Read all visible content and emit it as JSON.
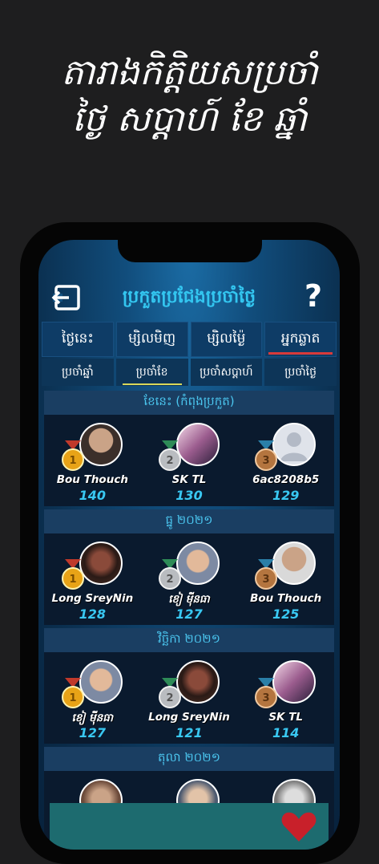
{
  "promo": {
    "line1": "តារាងកិត្តិយសប្រចាំ",
    "line2": "ថ្ងៃ សប្ដាហ៍ ខែ ឆ្នាំ"
  },
  "header": {
    "title": "ប្រកួតប្រជែងប្រចាំថ្ងៃ",
    "help_label": "?"
  },
  "tabs": [
    {
      "label": "ថ្ងៃនេះ",
      "active": false
    },
    {
      "label": "ម្សិលមិញ",
      "active": false
    },
    {
      "label": "ម្សិលម្ង៉ៃ",
      "active": false
    },
    {
      "label": "អ្នកឆ្លាត",
      "active": true
    }
  ],
  "subtabs": [
    {
      "label": "ប្រចាំឆ្នាំ",
      "active": false
    },
    {
      "label": "ប្រចាំខែ",
      "active": true
    },
    {
      "label": "ប្រចាំសប្ដាហ៍",
      "active": false
    },
    {
      "label": "ប្រចាំថ្ងៃ",
      "active": false
    }
  ],
  "sections": [
    {
      "title": "ខែនេះ (កំពុងប្រកួត)",
      "players": [
        {
          "rank": "1",
          "name": "Bou Thouch",
          "score": "140",
          "avatar": "person-photo"
        },
        {
          "rank": "2",
          "name": "SK TL",
          "score": "130",
          "avatar": "person-photo"
        },
        {
          "rank": "3",
          "name": "6ac8208b5",
          "score": "129",
          "avatar": "default-avatar"
        }
      ]
    },
    {
      "title": "ធ្នូ ២០២១",
      "players": [
        {
          "rank": "1",
          "name": "Long SreyNin",
          "score": "128",
          "avatar": "person-photo"
        },
        {
          "rank": "2",
          "name": "ខៀ ម៉ីនធា",
          "score": "127",
          "avatar": "child-photo"
        },
        {
          "rank": "3",
          "name": "Bou Thouch",
          "score": "125",
          "avatar": "person-photo"
        }
      ]
    },
    {
      "title": "វិច្ឆិកា ២០២១",
      "players": [
        {
          "rank": "1",
          "name": "ខៀ ម៉ីនធា",
          "score": "127",
          "avatar": "child-photo"
        },
        {
          "rank": "2",
          "name": "Long SreyNin",
          "score": "121",
          "avatar": "person-photo"
        },
        {
          "rank": "3",
          "name": "SK TL",
          "score": "114",
          "avatar": "person-photo"
        }
      ]
    },
    {
      "title": "តុលា ២០២១",
      "players": []
    }
  ],
  "colors": {
    "gold": "#e8a317",
    "silver": "#b9bcc0",
    "bronze": "#b4753f",
    "accent": "#33c6f0"
  }
}
